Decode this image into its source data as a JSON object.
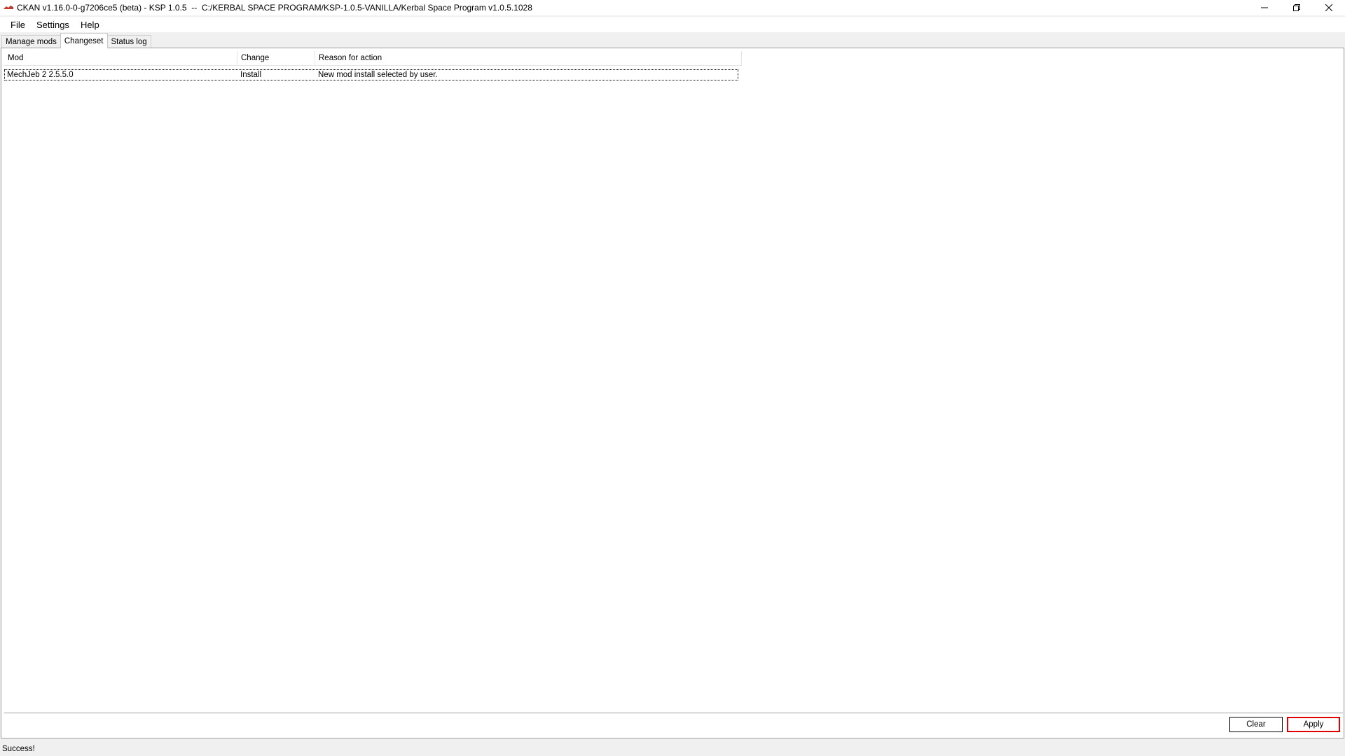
{
  "window": {
    "title": "CKAN v1.16.0-0-g7206ce5 (beta) - KSP 1.0.5  --  C:/KERBAL SPACE PROGRAM/KSP-1.0.5-VANILLA/Kerbal Space Program v1.0.5.1028",
    "app_icon": "ckan-logo-icon",
    "controls": {
      "minimize": "—",
      "restore": "❐",
      "close": "✕"
    }
  },
  "menubar": {
    "items": [
      "File",
      "Settings",
      "Help"
    ]
  },
  "tabs": [
    {
      "label": "Manage mods",
      "active": false
    },
    {
      "label": "Changeset",
      "active": true
    },
    {
      "label": "Status log",
      "active": false
    }
  ],
  "changeset": {
    "columns": [
      "Mod",
      "Change",
      "Reason for action"
    ],
    "rows": [
      {
        "mod": "MechJeb 2 2.5.5.0",
        "change": "Install",
        "reason": "New mod install selected by user."
      }
    ]
  },
  "buttons": {
    "clear": "Clear",
    "apply": "Apply"
  },
  "statusbar": {
    "text": "Success!"
  },
  "colors": {
    "highlight_border": "#e00000"
  }
}
